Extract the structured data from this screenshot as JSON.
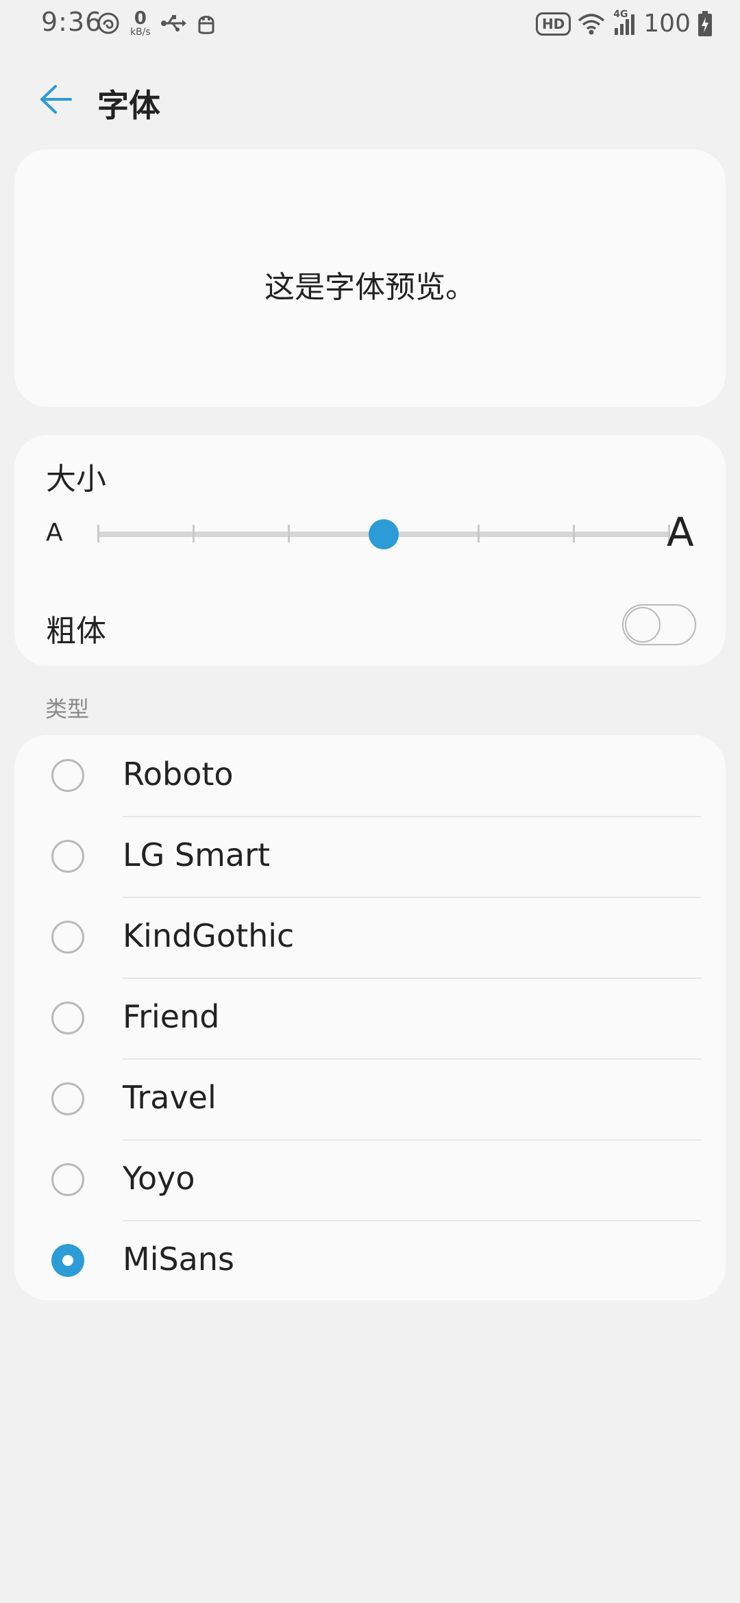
{
  "status_bar": {
    "time": "9:36",
    "net_speed_value": "0",
    "net_speed_unit": "kB/s",
    "hd_badge": "HD",
    "network_type": "4G",
    "battery_level": "100",
    "icons": [
      "nfc-icon",
      "usb-icon",
      "android-icon",
      "wifi-icon",
      "signal-icon",
      "battery-charging-icon"
    ]
  },
  "header": {
    "title": "字体",
    "back_icon": "back-arrow-icon"
  },
  "preview": {
    "text": "这是字体预览。"
  },
  "size_section": {
    "label": "大小",
    "small_a": "A",
    "large_a": "A",
    "steps": 7,
    "selected_step": 3
  },
  "bold": {
    "label": "粗体",
    "enabled": false
  },
  "type_section": {
    "label": "类型",
    "selected": "MiSans",
    "options": [
      "Roboto",
      "LG Smart",
      "KindGothic",
      "Friend",
      "Travel",
      "Yoyo",
      "MiSans"
    ]
  },
  "colors": {
    "accent": "#2b9cd6",
    "background": "#f1f1f1",
    "card": "#fafafa"
  }
}
